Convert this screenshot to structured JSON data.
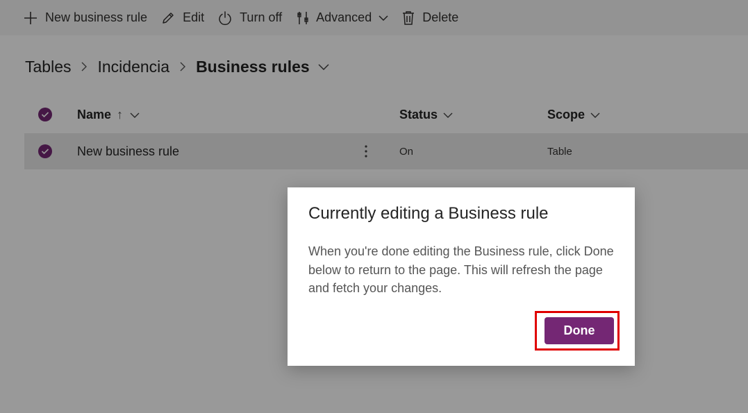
{
  "toolbar": {
    "new_business_rule": "New business rule",
    "edit": "Edit",
    "turn_off": "Turn off",
    "advanced": "Advanced",
    "delete": "Delete"
  },
  "breadcrumb": {
    "items": [
      "Tables",
      "Incidencia"
    ],
    "current": "Business rules"
  },
  "table": {
    "columns": {
      "name": "Name",
      "status": "Status",
      "scope": "Scope"
    },
    "sort": "↑",
    "rows": [
      {
        "name": "New business rule",
        "status": "On",
        "scope": "Table"
      }
    ]
  },
  "dialog": {
    "title": "Currently editing a Business rule",
    "body": "When you're done editing the Business rule, click Done below to return to the page. This will refresh the page and fetch your changes.",
    "done_label": "Done"
  },
  "colors": {
    "accent": "#742774",
    "highlight": "#e00000",
    "overlay": "rgba(0,0,0,0.4)"
  }
}
